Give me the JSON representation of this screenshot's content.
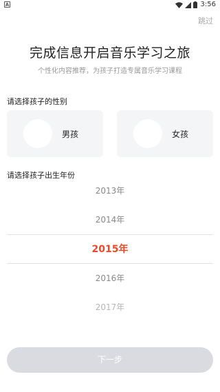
{
  "status_bar": {
    "notification_icon_label": "A",
    "time": "3:56"
  },
  "header": {
    "skip_label": "跳过",
    "title": "完成信息开启音乐学习之旅",
    "subtitle": "个性化内容推荐，为孩子打造专属音乐学习课程"
  },
  "gender": {
    "section_label": "请选择孩子的性别",
    "options": [
      {
        "label": "男孩"
      },
      {
        "label": "女孩"
      }
    ]
  },
  "birth_year": {
    "section_label": "请选择孩子出生年份",
    "years": [
      "2013年",
      "2014年",
      "2015年",
      "2016年",
      "2017年"
    ],
    "selected": "2015年"
  },
  "footer": {
    "next_label": "下一步"
  },
  "colors": {
    "accent": "#e94a2c",
    "card_bg": "#f4f5f7",
    "button_disabled": "#d9dbe0"
  }
}
